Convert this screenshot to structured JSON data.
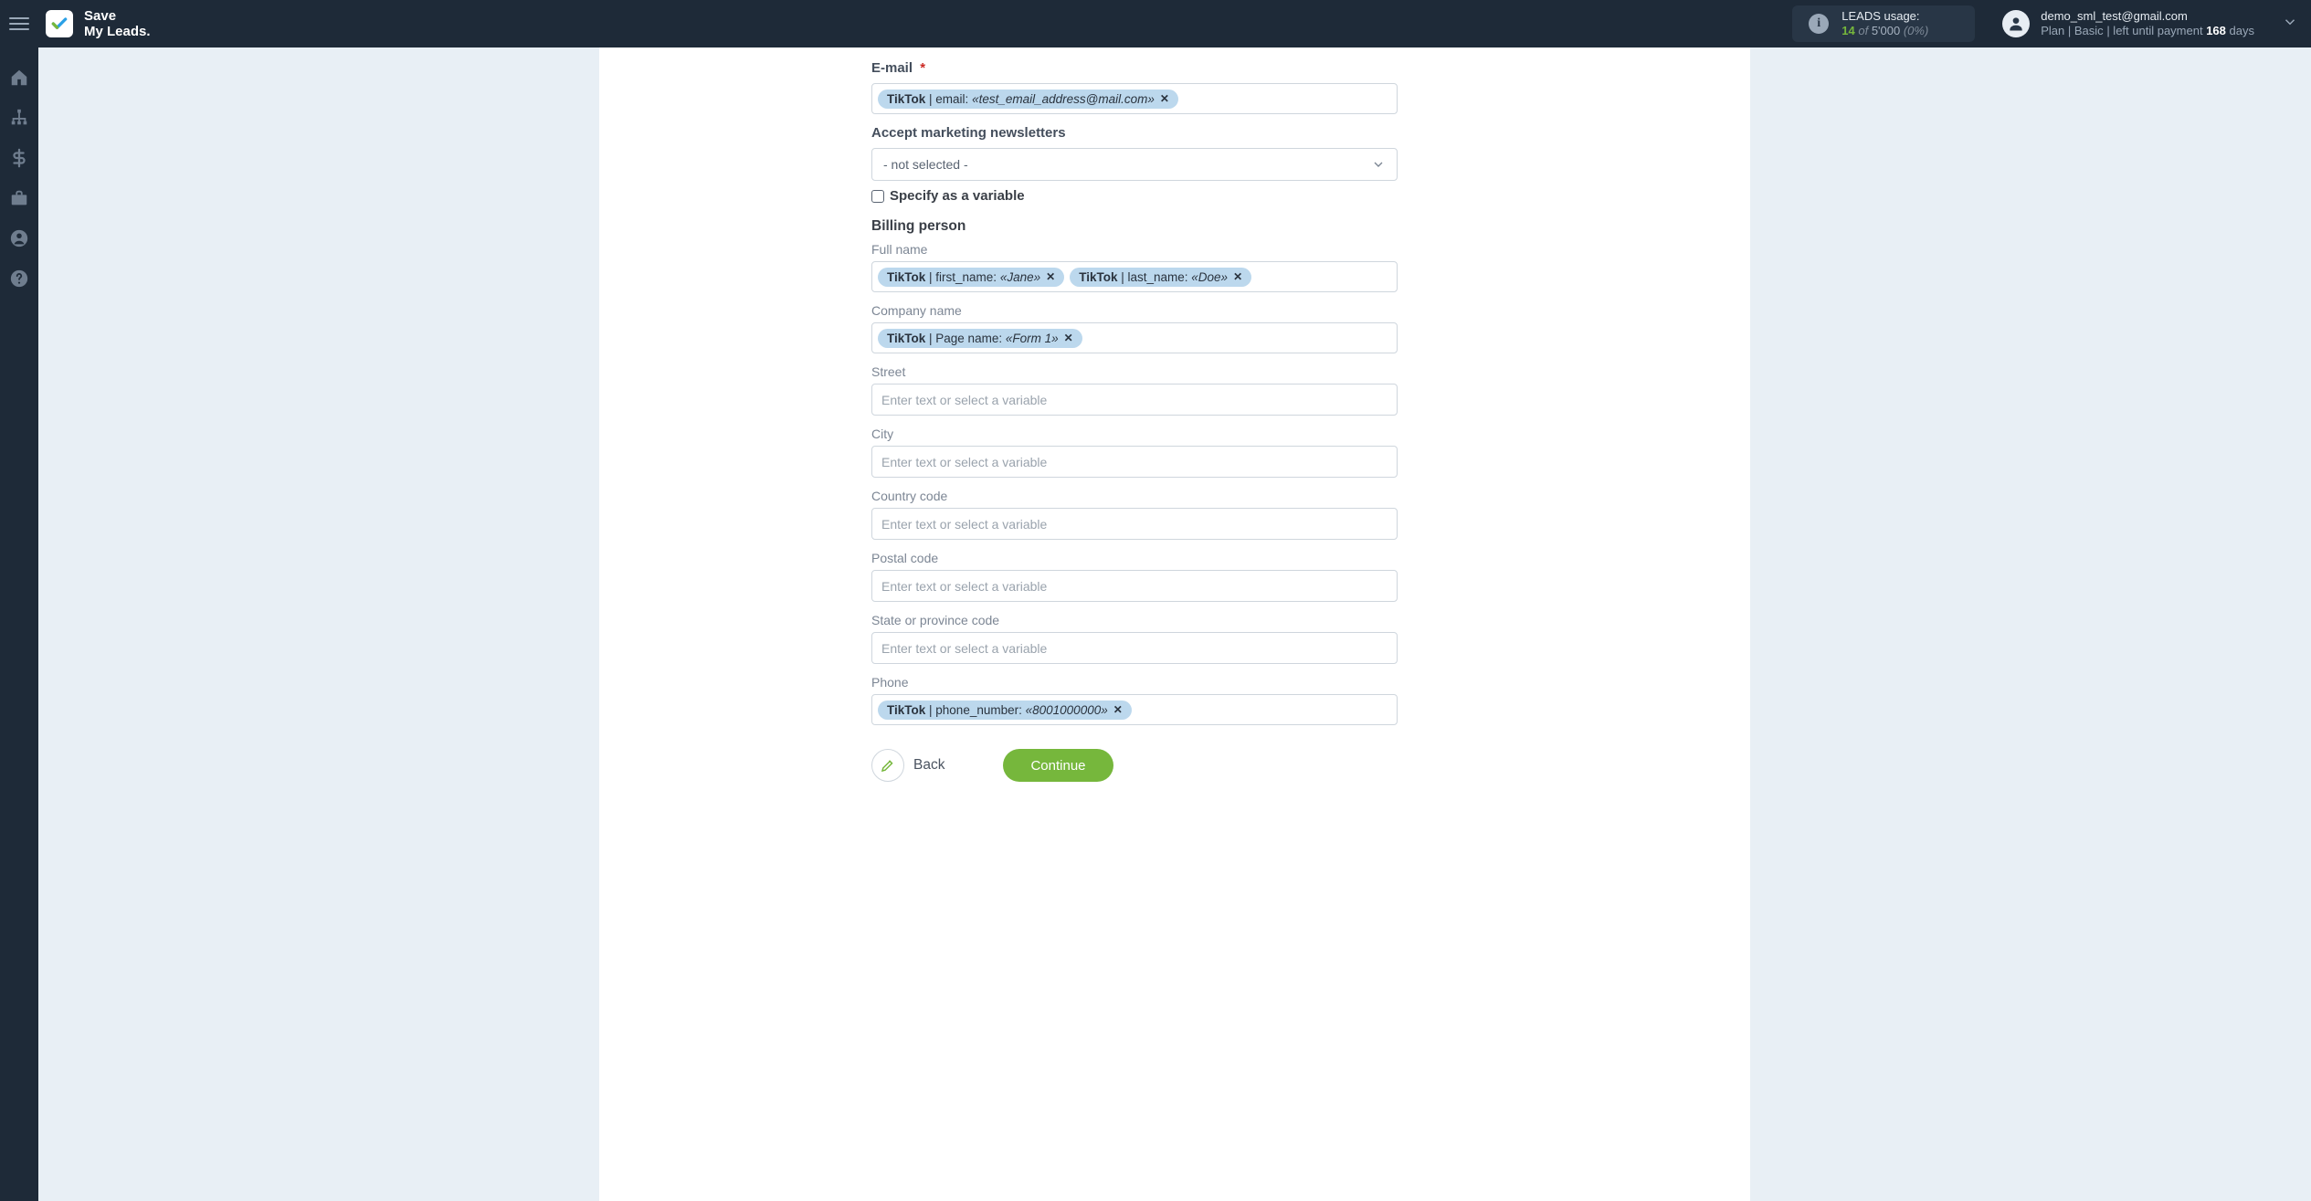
{
  "brand": {
    "line1": "Save",
    "line2": "My Leads"
  },
  "header": {
    "usage": {
      "title": "LEADS usage:",
      "count": "14",
      "of": "of",
      "max": "5'000",
      "pct": "(0%)"
    },
    "user": {
      "email": "demo_sml_test@gmail.com",
      "plan_prefix": "Plan |",
      "plan_name": "Basic",
      "plan_mid": "| left until payment",
      "days": "168",
      "days_suffix": "days"
    }
  },
  "form": {
    "email": {
      "label": "E-mail",
      "tag_source": "TikTok",
      "tag_field": "email:",
      "tag_value": "«test_email_address@mail.com»"
    },
    "newsletter": {
      "label": "Accept marketing newsletters",
      "selected": "- not selected -",
      "specify_var": "Specify as a variable"
    },
    "billing_title": "Billing person",
    "fullname": {
      "label": "Full name",
      "t1_source": "TikTok",
      "t1_field": "first_name:",
      "t1_value": "«Jane»",
      "t2_source": "TikTok",
      "t2_field": "last_name:",
      "t2_value": "«Doe»"
    },
    "company": {
      "label": "Company name",
      "tag_source": "TikTok",
      "tag_field": "Page name:",
      "tag_value": "«Form 1»"
    },
    "street": {
      "label": "Street"
    },
    "city": {
      "label": "City"
    },
    "country": {
      "label": "Country code"
    },
    "postal": {
      "label": "Postal code"
    },
    "state": {
      "label": "State or province code"
    },
    "phone": {
      "label": "Phone",
      "tag_source": "TikTok",
      "tag_field": "phone_number:",
      "tag_value": "«8001000000»"
    },
    "placeholder": "Enter text or select a variable",
    "back": "Back",
    "continue": "Continue"
  }
}
